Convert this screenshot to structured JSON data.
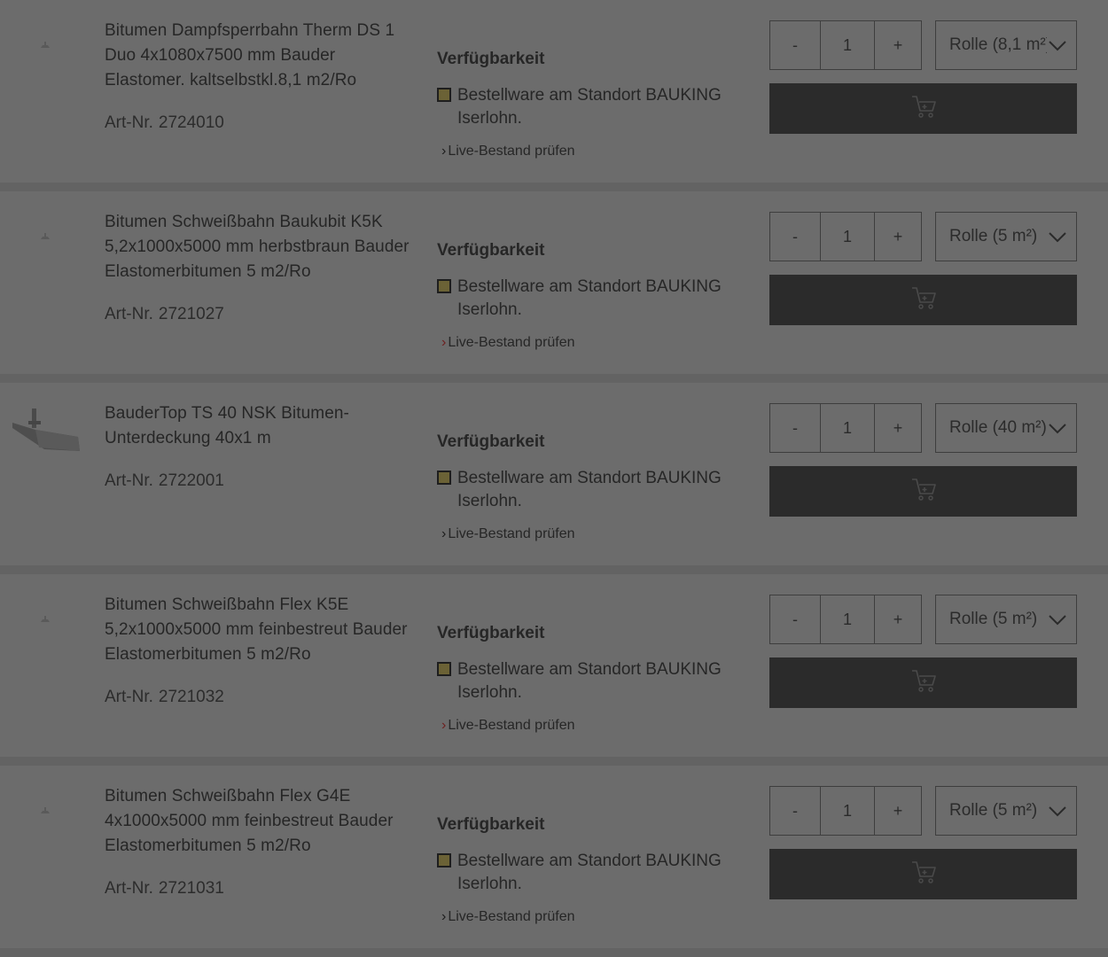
{
  "availability_heading": "Verfügbarkeit",
  "live_link_label": "Live-Bestand prüfen",
  "art_label": "Art-Nr.",
  "qty_minus": "-",
  "qty_plus": "+",
  "status_color": "#6b6236",
  "products": [
    {
      "name": "Bitumen Dampfsperrbahn Therm DS 1 Duo 4x1080x7500 mm Bauder Elastomer. kaltselbstkl.8,1 m2/Ro",
      "art_nr": "2724010",
      "availability": "Bestellware am Standort BAUKING Iserlohn.",
      "quantity": "1",
      "unit": "Rolle (8,1 m²)"
    },
    {
      "name": "Bitumen Schweißbahn Baukubit K5K 5,2x1000x5000 mm herbstbraun Bauder Elastomerbitumen 5 m2/Ro",
      "art_nr": "2721027",
      "availability": "Bestellware am Standort BAUKING Iserlohn.",
      "quantity": "1",
      "unit": "Rolle (5 m²)"
    },
    {
      "name": "BauderTop TS 40 NSK Bitumen-Unterdeckung 40x1 m",
      "art_nr": "2722001",
      "availability": "Bestellware am Standort BAUKING Iserlohn.",
      "quantity": "1",
      "unit": "Rolle (40 m²)"
    },
    {
      "name": "Bitumen Schweißbahn Flex K5E 5,2x1000x5000 mm feinbestreut Bauder Elastomerbitumen 5 m2/Ro",
      "art_nr": "2721032",
      "availability": "Bestellware am Standort BAUKING Iserlohn.",
      "quantity": "1",
      "unit": "Rolle (5 m²)"
    },
    {
      "name": "Bitumen Schweißbahn Flex G4E 4x1000x5000 mm feinbestreut Bauder Elastomerbitumen 5 m2/Ro",
      "art_nr": "2721031",
      "availability": "Bestellware am Standort BAUKING Iserlohn.",
      "quantity": "1",
      "unit": "Rolle (5 m²)"
    }
  ]
}
